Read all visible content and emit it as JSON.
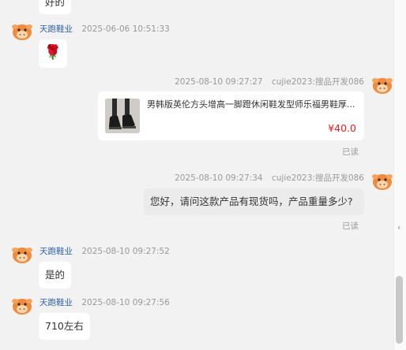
{
  "messages": {
    "m0_text": "好的",
    "m1_sender": "天跑鞋业",
    "m1_time": "2025-06-06 10:51:33",
    "m1_content": "🌹",
    "m2_time": "2025-08-10 09:27:27",
    "m2_sender": "cujie2023:搜品开发086",
    "m2_product_title": "男韩版英伦方头增高一脚蹬休闲鞋发型师乐福男鞋厚...",
    "m2_product_price": "¥40.0",
    "m2_read": "已读",
    "m3_time": "2025-08-10 09:27:34",
    "m3_sender": "cujie2023:搜品开发086",
    "m3_text": "您好，请问这款产品有现货吗，产品重量多少?",
    "m3_read": "已读",
    "m4_sender": "天跑鞋业",
    "m4_time": "2025-08-10 09:27:52",
    "m4_text": "是的",
    "m5_sender": "天跑鞋业",
    "m5_time": "2025-08-10 09:27:56",
    "m5_text": "710左右"
  },
  "icons": {
    "avatar": "cartoon-cow-avatar-icon",
    "collapse": "chevron-left-icon",
    "rose": "rose-emoji"
  },
  "colors": {
    "sender_name": "#2b5fa8",
    "price": "#e02020",
    "avatar_primary": "#f08a3c",
    "background": "#f2f2f2"
  }
}
